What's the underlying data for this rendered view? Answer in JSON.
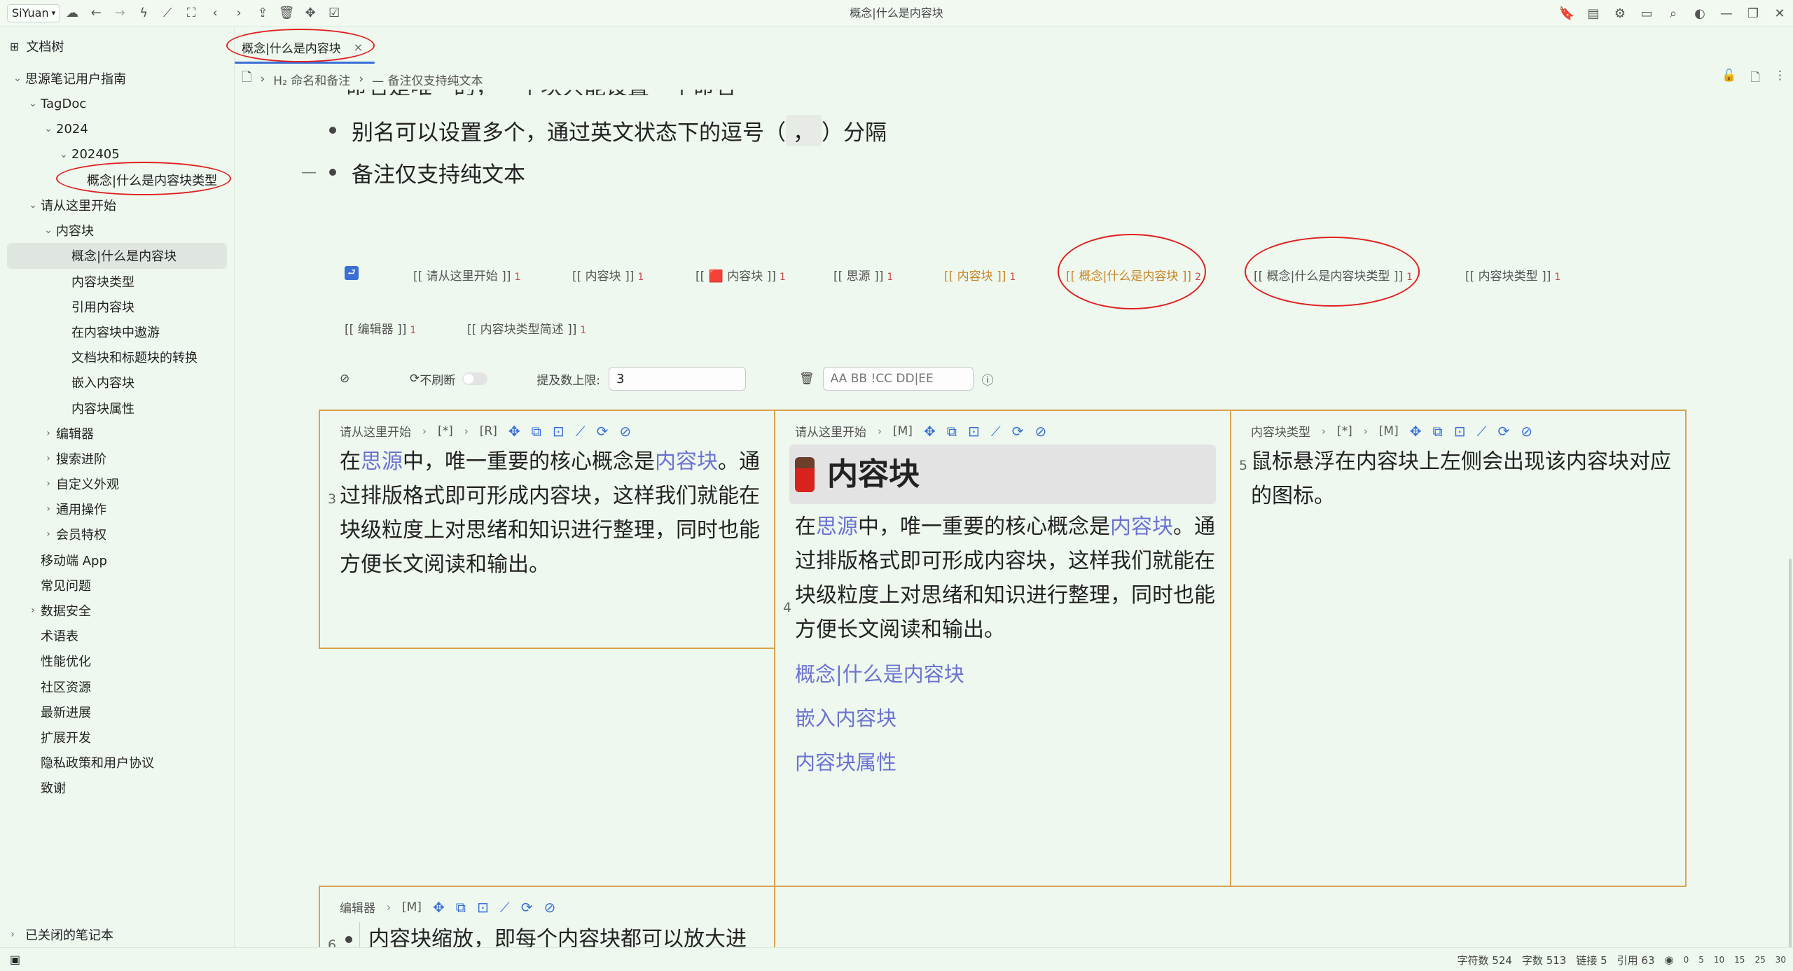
{
  "topbar": {
    "workspace": "SiYuan",
    "window_title": "概念|什么是内容块",
    "left_icons": [
      "cloud-icon",
      "back-icon",
      "forward-icon",
      "lightning-icon",
      "graph-icon",
      "screenshot-icon",
      "chevron-left-icon",
      "chevron-right-icon",
      "upload-icon",
      "trash-icon",
      "move-icon",
      "checkbox-icon"
    ],
    "right_icons": [
      "bookmark-icon",
      "layout-icon",
      "plugin-icon",
      "terminal-icon",
      "search-icon",
      "theme-icon",
      "minimize-icon",
      "restore-icon",
      "close-icon"
    ]
  },
  "sidebar": {
    "title": "文档树",
    "items": [
      {
        "label": "思源笔记用户指南",
        "level": 0,
        "arrow": "down"
      },
      {
        "label": "TagDoc",
        "level": 1,
        "arrow": "down"
      },
      {
        "label": "2024",
        "level": 2,
        "arrow": "down"
      },
      {
        "label": "202405",
        "level": 3,
        "arrow": "down"
      },
      {
        "label": "概念|什么是内容块类型",
        "level": 4,
        "arrow": ""
      },
      {
        "label": "请从这里开始",
        "level": 1,
        "arrow": "down"
      },
      {
        "label": "内容块",
        "level": 2,
        "arrow": "down"
      },
      {
        "label": "概念|什么是内容块",
        "level": 3,
        "arrow": "",
        "selected": true
      },
      {
        "label": "内容块类型",
        "level": 3,
        "arrow": ""
      },
      {
        "label": "引用内容块",
        "level": 3,
        "arrow": ""
      },
      {
        "label": "在内容块中遨游",
        "level": 3,
        "arrow": ""
      },
      {
        "label": "文档块和标题块的转换",
        "level": 3,
        "arrow": ""
      },
      {
        "label": "嵌入内容块",
        "level": 3,
        "arrow": ""
      },
      {
        "label": "内容块属性",
        "level": 3,
        "arrow": ""
      },
      {
        "label": "编辑器",
        "level": 2,
        "arrow": "right"
      },
      {
        "label": "搜索进阶",
        "level": 2,
        "arrow": "right"
      },
      {
        "label": "自定义外观",
        "level": 2,
        "arrow": "right"
      },
      {
        "label": "通用操作",
        "level": 2,
        "arrow": "right"
      },
      {
        "label": "会员特权",
        "level": 2,
        "arrow": "right"
      },
      {
        "label": "移动端 App",
        "level": 1,
        "arrow": ""
      },
      {
        "label": "常见问题",
        "level": 1,
        "arrow": ""
      },
      {
        "label": "数据安全",
        "level": 1,
        "arrow": "right"
      },
      {
        "label": "术语表",
        "level": 1,
        "arrow": ""
      },
      {
        "label": "性能优化",
        "level": 1,
        "arrow": ""
      },
      {
        "label": "社区资源",
        "level": 1,
        "arrow": ""
      },
      {
        "label": "最新进展",
        "level": 1,
        "arrow": ""
      },
      {
        "label": "扩展开发",
        "level": 1,
        "arrow": ""
      },
      {
        "label": "隐私政策和用户协议",
        "level": 1,
        "arrow": ""
      },
      {
        "label": "致谢",
        "level": 1,
        "arrow": ""
      }
    ],
    "closed_notebooks": "已关闭的笔记本"
  },
  "tab": {
    "label": "概念|什么是内容块",
    "close": "×"
  },
  "breadcrumb": {
    "items": [
      "H₂ 命名和备注",
      "— 备注仅支持纯文本"
    ]
  },
  "editor": {
    "partial_line": "命名是唯一的，一个块只能设置一个命名",
    "bullet1_pre": "别名可以设置多个，通过英文状态下的逗号（",
    "bullet1_code": "，",
    "bullet1_post": "）分隔",
    "bullet2": "备注仅支持纯文本",
    "bullet2_marker": "—"
  },
  "backlinks": {
    "refs": [
      {
        "label": "[[ 请从这里开始 ]]",
        "count": "1"
      },
      {
        "label": "[[ 内容块 ]]",
        "count": "1"
      },
      {
        "label": "[[ 🟥 内容块 ]]",
        "count": "1"
      },
      {
        "label": "[[ 思源 ]]",
        "count": "1"
      },
      {
        "label": "[[ 内容块 ]]",
        "count": "1",
        "highlight": true
      },
      {
        "label": "[[ 概念|什么是内容块 ]]",
        "count": "2",
        "highlight": true
      },
      {
        "label": "[[ 概念|什么是内容块类型 ]]",
        "count": "1"
      },
      {
        "label": "[[ 内容块类型 ]]",
        "count": "1"
      },
      {
        "label": "[[ 编辑器 ]]",
        "count": "1"
      },
      {
        "label": "[[ 内容块类型简述 ]]",
        "count": "1"
      }
    ],
    "no_refresh_label": "不刷断",
    "mention_limit_label": "提及数上限:",
    "mention_limit_value": "3",
    "keyword_placeholder": "AA BB !CC DD|EE"
  },
  "cards": [
    {
      "num": "3",
      "toolbar": [
        "请从这里开始",
        "[*]",
        "[R]"
      ],
      "text_pre": "在",
      "link1": "思源",
      "text_mid": "中，唯一重要的核心概念是",
      "link2": "内容块",
      "text_post": "。通过排版格式即可形成内容块，这样我们就能在块级粒度上对思绪和知识进行整理，同时也能方便长文阅读和输出。"
    },
    {
      "num": "4",
      "toolbar": [
        "请从这里开始",
        "[M]"
      ],
      "heading": "内容块",
      "text_pre": "在",
      "link1": "思源",
      "text_mid": "中，唯一重要的核心概念是",
      "link2": "内容块",
      "text_post": "。通过排版格式即可形成内容块，这样我们就能在块级粒度上对思绪和知识进行整理，同时也能方便长文阅读和输出。",
      "links": [
        "概念|什么是内容块",
        "嵌入内容块",
        "内容块属性"
      ]
    },
    {
      "num": "5",
      "toolbar": [
        "内容块类型",
        "[*]",
        "[M]"
      ],
      "text": "鼠标悬浮在内容块上左侧会出现该内容块对应的图标。"
    },
    {
      "num": "6",
      "toolbar": [
        "编辑器",
        "[M]"
      ],
      "text": "内容块缩放，即每个内容块都可以放大进入聚焦"
    }
  ],
  "statusbar": {
    "chars": "字符数 524",
    "words": "字数 513",
    "links": "链接 5",
    "refs": "引用 63",
    "zoom": [
      "0",
      "5",
      "10",
      "15",
      "25",
      "30"
    ]
  },
  "colors": {
    "accent": "#3b6fd6",
    "card_border": "#d7a34f",
    "link": "#6b73d1",
    "background": "#eef8ee",
    "annotation": "#e02020"
  }
}
